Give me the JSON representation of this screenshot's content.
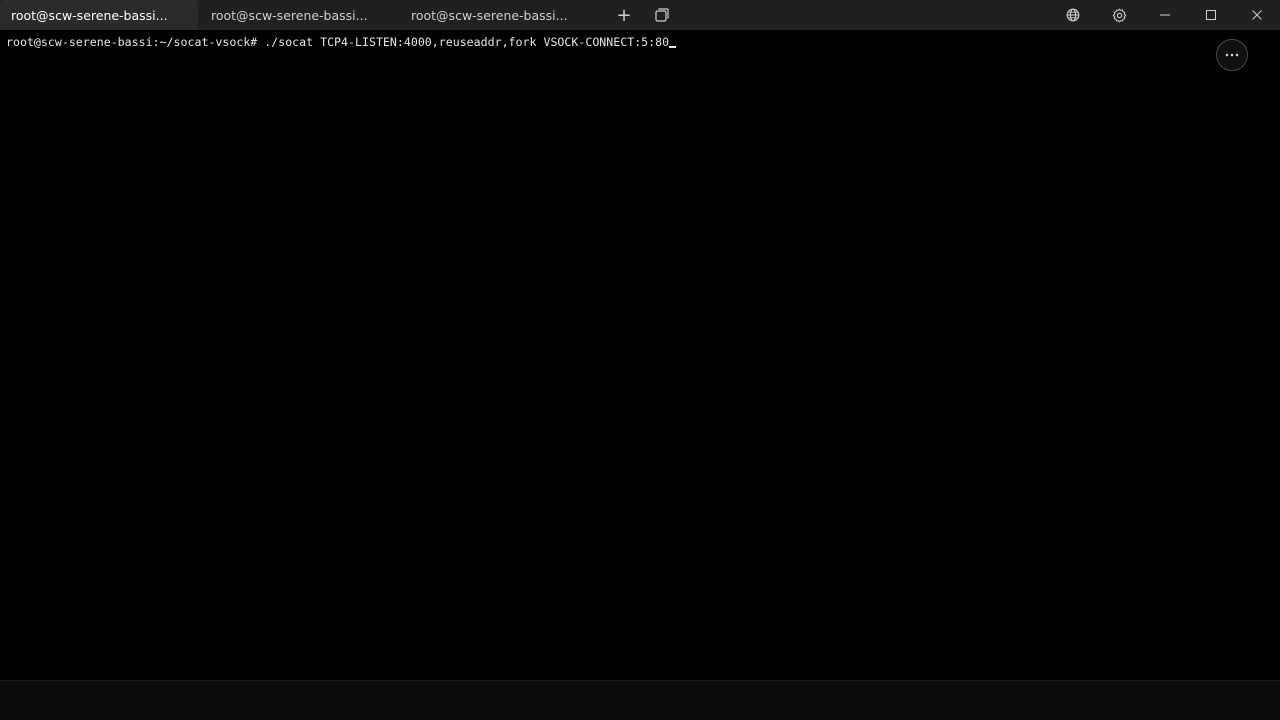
{
  "tabs": [
    {
      "label": "root@scw-serene-bassi...",
      "active": true
    },
    {
      "label": "root@scw-serene-bassi...",
      "active": false
    },
    {
      "label": "root@scw-serene-bassi...",
      "active": false
    }
  ],
  "titlebar": {
    "new_tab_glyph": "+",
    "icons": {
      "duplicate": "duplicate-tab-icon",
      "globe": "globe-icon",
      "settings": "gear-icon",
      "minimize": "minimize-icon",
      "maximize": "maximize-icon",
      "close": "close-icon",
      "more": "more-options-icon"
    }
  },
  "terminal": {
    "prompt": "root@scw-serene-bassi:~/socat-vsock#",
    "command": " ./socat TCP4-LISTEN:4000,reuseaddr,fork VSOCK-CONNECT:5:80"
  },
  "colors": {
    "background": "#000000",
    "titlebar": "#202020",
    "active_tab": "#2b2b2b",
    "text": "#e6e6e6"
  }
}
